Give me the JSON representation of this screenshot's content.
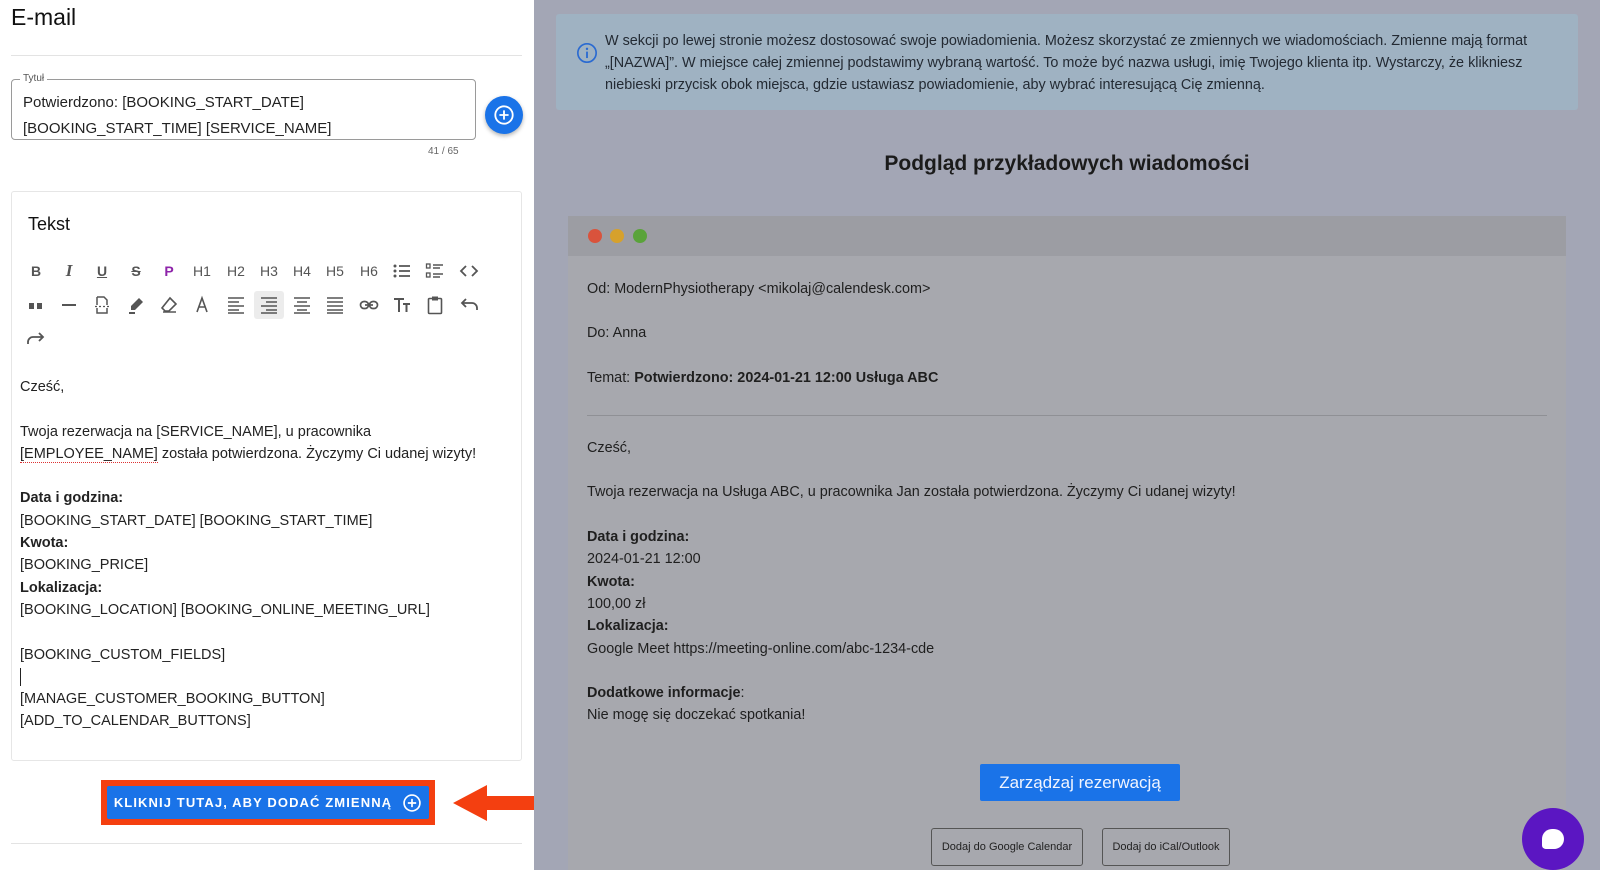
{
  "left": {
    "title": "E-mail",
    "subject_field": {
      "label": "Tytuł",
      "value": "Potwierdzono: [BOOKING_START_DATE] [BOOKING_START_TIME] [SERVICE_NAME]",
      "counter": "41 / 65"
    },
    "editor": {
      "title": "Tekst",
      "toolbar": {
        "bold": "B",
        "italic": "I",
        "underline": "U",
        "strike": "S",
        "paragraph": "P",
        "h1": "H1",
        "h2": "H2",
        "h3": "H3",
        "h4": "H4",
        "h5": "H5",
        "h6": "H6"
      },
      "body": {
        "greeting": "Cześć,",
        "line1a": "Twoja rezerwacja na [SERVICE_NAME], u pracownika",
        "line1b_var": "[EMPLOYEE_NAME]",
        "line1b_rest": " została potwierdzona. Życzymy Ci udanej wizyty!",
        "date_label": "Data i godzina:",
        "date_value": "[BOOKING_START_DATE] [BOOKING_START_TIME]",
        "price_label": "Kwota:",
        "price_value": "[BOOKING_PRICE]",
        "location_label": "Lokalizacja:",
        "location_value": "[BOOKING_LOCATION] [BOOKING_ONLINE_MEETING_URL]",
        "custom_fields": "[BOOKING_CUSTOM_FIELDS]",
        "manage_button": "[MANAGE_CUSTOMER_BOOKING_BUTTON]",
        "calendar_buttons": "[ADD_TO_CALENDAR_BUTTONS]"
      }
    },
    "add_variable_button": "KLIKNIJ TUTAJ, ABY DODAĆ ZMIENNĄ"
  },
  "right": {
    "info": "W sekcji po lewej stronie możesz dostosować swoje powiadomienia. Możesz skorzystać ze zmiennych we wiadomościach. Zmienne mają format „[NAZWA]”. W miejsce całej zmiennej podstawimy wybraną wartość. To może być nazwa usługi, imię Twojego klienta itp. Wystarczy, że klikniesz niebieski przycisk obok miejsca, gdzie ustawiasz powiadomienie, aby wybrać interesującą Cię zmienną.",
    "preview_title": "Podgląd przykładowych wiadomości",
    "mail": {
      "from": "Od: ModernPhysiotherapy <mikolaj@calendesk.com>",
      "to": "Do: Anna",
      "subject_label": "Temat: ",
      "subject_value": "Potwierdzono: 2024-01-21 12:00 Usługa ABC",
      "greeting": "Cześć,",
      "line1": "Twoja rezerwacja na Usługa ABC, u pracownika Jan została potwierdzona. Życzymy Ci udanej wizyty!",
      "date_label": "Data i godzina:",
      "date_value": "2024-01-21 12:00",
      "price_label": "Kwota:",
      "price_value": "100,00 zł",
      "location_label": "Lokalizacja:",
      "location_value": "Google Meet https://meeting-online.com/abc-1234-cde",
      "extra_label": "Dodatkowe informacje",
      "extra_colon": ":",
      "extra_value": "Nie mogę się doczekać spotkania!",
      "manage_button": "Zarządzaj rezerwacją",
      "google_button": "Dodaj do Google Calendar",
      "ical_button": "Dodaj do iCal/Outlook"
    }
  },
  "colors": {
    "primary": "#1a73e8",
    "highlight": "#f43f10",
    "chat": "#5b16c2",
    "dot_red": "#d9533c",
    "dot_yellow": "#d6a12c",
    "dot_green": "#5aa33a"
  }
}
